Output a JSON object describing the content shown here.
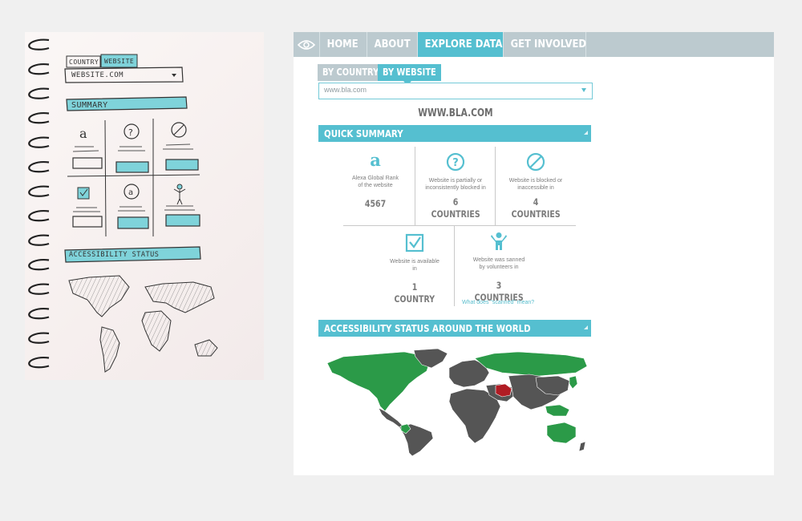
{
  "sketch": {
    "tabs": [
      "COUNTRY",
      "WEBSITE"
    ],
    "input_value": "WEBSITE.COM",
    "summary_label": "SUMMARY",
    "accessibility_label": "ACCESSIBILITY STATUS"
  },
  "nav": {
    "items": [
      "HOME",
      "ABOUT",
      "EXPLORE DATA",
      "GET INVOLVED"
    ],
    "active": "EXPLORE DATA",
    "logo_icon": "eye-icon"
  },
  "tabs": {
    "by_country": "BY COUNTRY",
    "by_website": "BY WEBSITE",
    "active": "BY WEBSITE"
  },
  "search": {
    "value": "www.bla.com"
  },
  "site_title": "WWW.BLA.COM",
  "quick_summary": {
    "title": "QUICK SUMMARY",
    "cells": [
      {
        "icon": "amazon-icon",
        "desc_line1": "Alexa Global Rank",
        "desc_line2": "of the website",
        "value": "4567",
        "unit": ""
      },
      {
        "icon": "question-circle-icon",
        "desc_line1": "Website is partially or",
        "desc_line2": "inconsistently blocked in",
        "value": "6",
        "unit": "COUNTRIES"
      },
      {
        "icon": "blocked-circle-icon",
        "desc_line1": "Website is blocked or",
        "desc_line2": "inaccessible in",
        "value": "4",
        "unit": "COUNTRIES"
      },
      {
        "icon": "checkbox-checked-icon",
        "desc_line1": "Website is available",
        "desc_line2": "in",
        "value": "1",
        "unit": "COUNTRY"
      },
      {
        "icon": "volunteer-person-icon",
        "desc_line1": "Website was sanned",
        "desc_line2": "by volunteers in",
        "value": "3",
        "unit": "COUNTRIES"
      }
    ],
    "help_link": "What does \"scanned\" mean?"
  },
  "accessibility": {
    "title": "ACCESSIBILITY STATUS AROUND THE WORLD"
  },
  "colors": {
    "accent": "#55bfd0",
    "nav_bg": "#bccacf",
    "map_available": "#2b9a48",
    "map_blocked": "#b01c24",
    "map_unknown": "#555555"
  }
}
